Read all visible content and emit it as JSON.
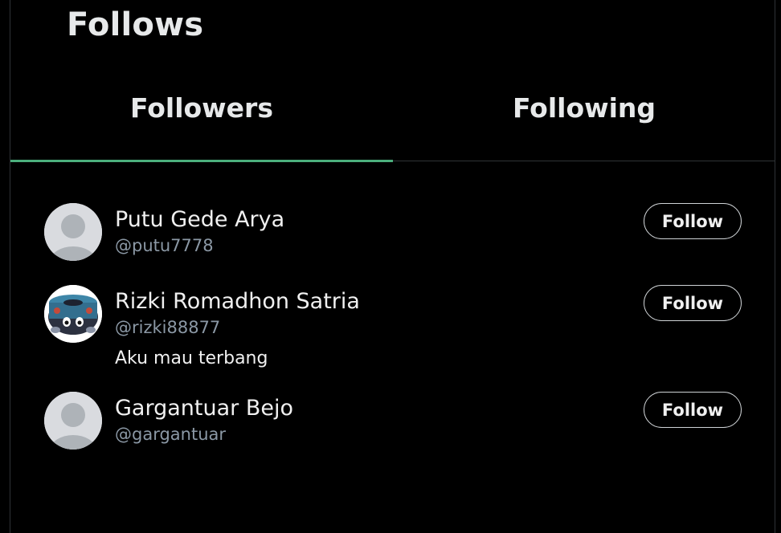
{
  "page": {
    "title": "Follows"
  },
  "tabs": [
    {
      "label": "Followers",
      "active": true
    },
    {
      "label": "Following",
      "active": false
    }
  ],
  "colors": {
    "background": "#000000",
    "active_tab_indicator": "#4caf7d",
    "handle_text": "#8b98a5"
  },
  "followers": [
    {
      "name": "Putu Gede Arya",
      "handle": "@putu7778",
      "bio": "",
      "avatar": "default-avatar-icon",
      "button_label": "Follow"
    },
    {
      "name": "Rizki Romadhon Satria",
      "handle": "@rizki88877",
      "bio": "Aku mau terbang",
      "avatar": "custom-avatar-image",
      "button_label": "Follow"
    },
    {
      "name": "Gargantuar Bejo",
      "handle": "@gargantuar",
      "bio": "",
      "avatar": "default-avatar-icon",
      "button_label": "Follow"
    }
  ]
}
